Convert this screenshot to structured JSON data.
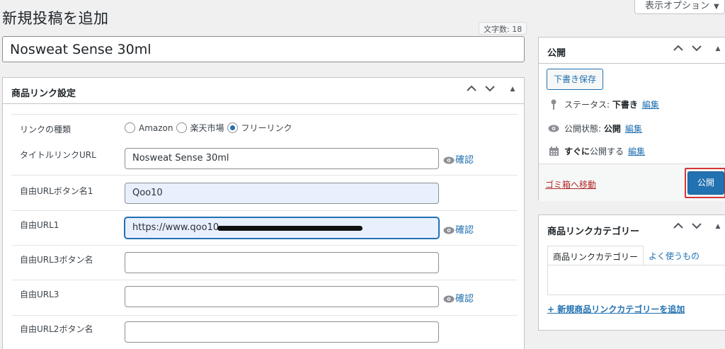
{
  "page": {
    "title": "新規投稿を追加",
    "screen_options": "表示オプション",
    "word_count_label": "文字数: 18",
    "post_title": "Nosweat Sense 30ml"
  },
  "product_link_box": {
    "title": "商品リンク設定",
    "link_type": {
      "label": "リンクの種類",
      "options": [
        "Amazon",
        "楽天市場",
        "フリーリンク"
      ],
      "selected": "フリーリンク"
    },
    "confirm_label": "確認",
    "fields": [
      {
        "label": "タイトルリンクURL",
        "value": "Nosweat Sense 30ml"
      },
      {
        "label": "自由URLボタン名1",
        "value": "Qoo10"
      },
      {
        "label": "自由URL1",
        "value": "https://www.qoo10"
      },
      {
        "label": "自由URL3ボタン名",
        "value": ""
      },
      {
        "label": "自由URL3",
        "value": ""
      },
      {
        "label": "自由URL2ボタン名",
        "value": ""
      }
    ]
  },
  "publish_box": {
    "title": "公開",
    "save_draft": "下書き保存",
    "status_label": "ステータス:",
    "status_value": "下書き",
    "visibility_label": "公開状態:",
    "visibility_value": "公開",
    "schedule_bold": "すぐに",
    "schedule_label": "公開する",
    "edit_label": "編集",
    "trash": "ゴミ箱へ移動",
    "publish_button": "公開"
  },
  "category_box": {
    "title": "商品リンクカテゴリー",
    "tab_all": "商品リンクカテゴリー",
    "tab_popular": "よく使うもの",
    "add_new": "+ 新規商品リンクカテゴリーを追加"
  },
  "colors": {
    "accent": "#2271b1",
    "danger": "#b32d2e",
    "highlight_outline": "#d63638",
    "autofill_bg": "#e8f0fe"
  },
  "icons": [
    "chevron-up-icon",
    "chevron-down-icon",
    "caret-up-icon",
    "eye-icon",
    "pin-icon",
    "calendar-icon",
    "caret-down-icon"
  ]
}
